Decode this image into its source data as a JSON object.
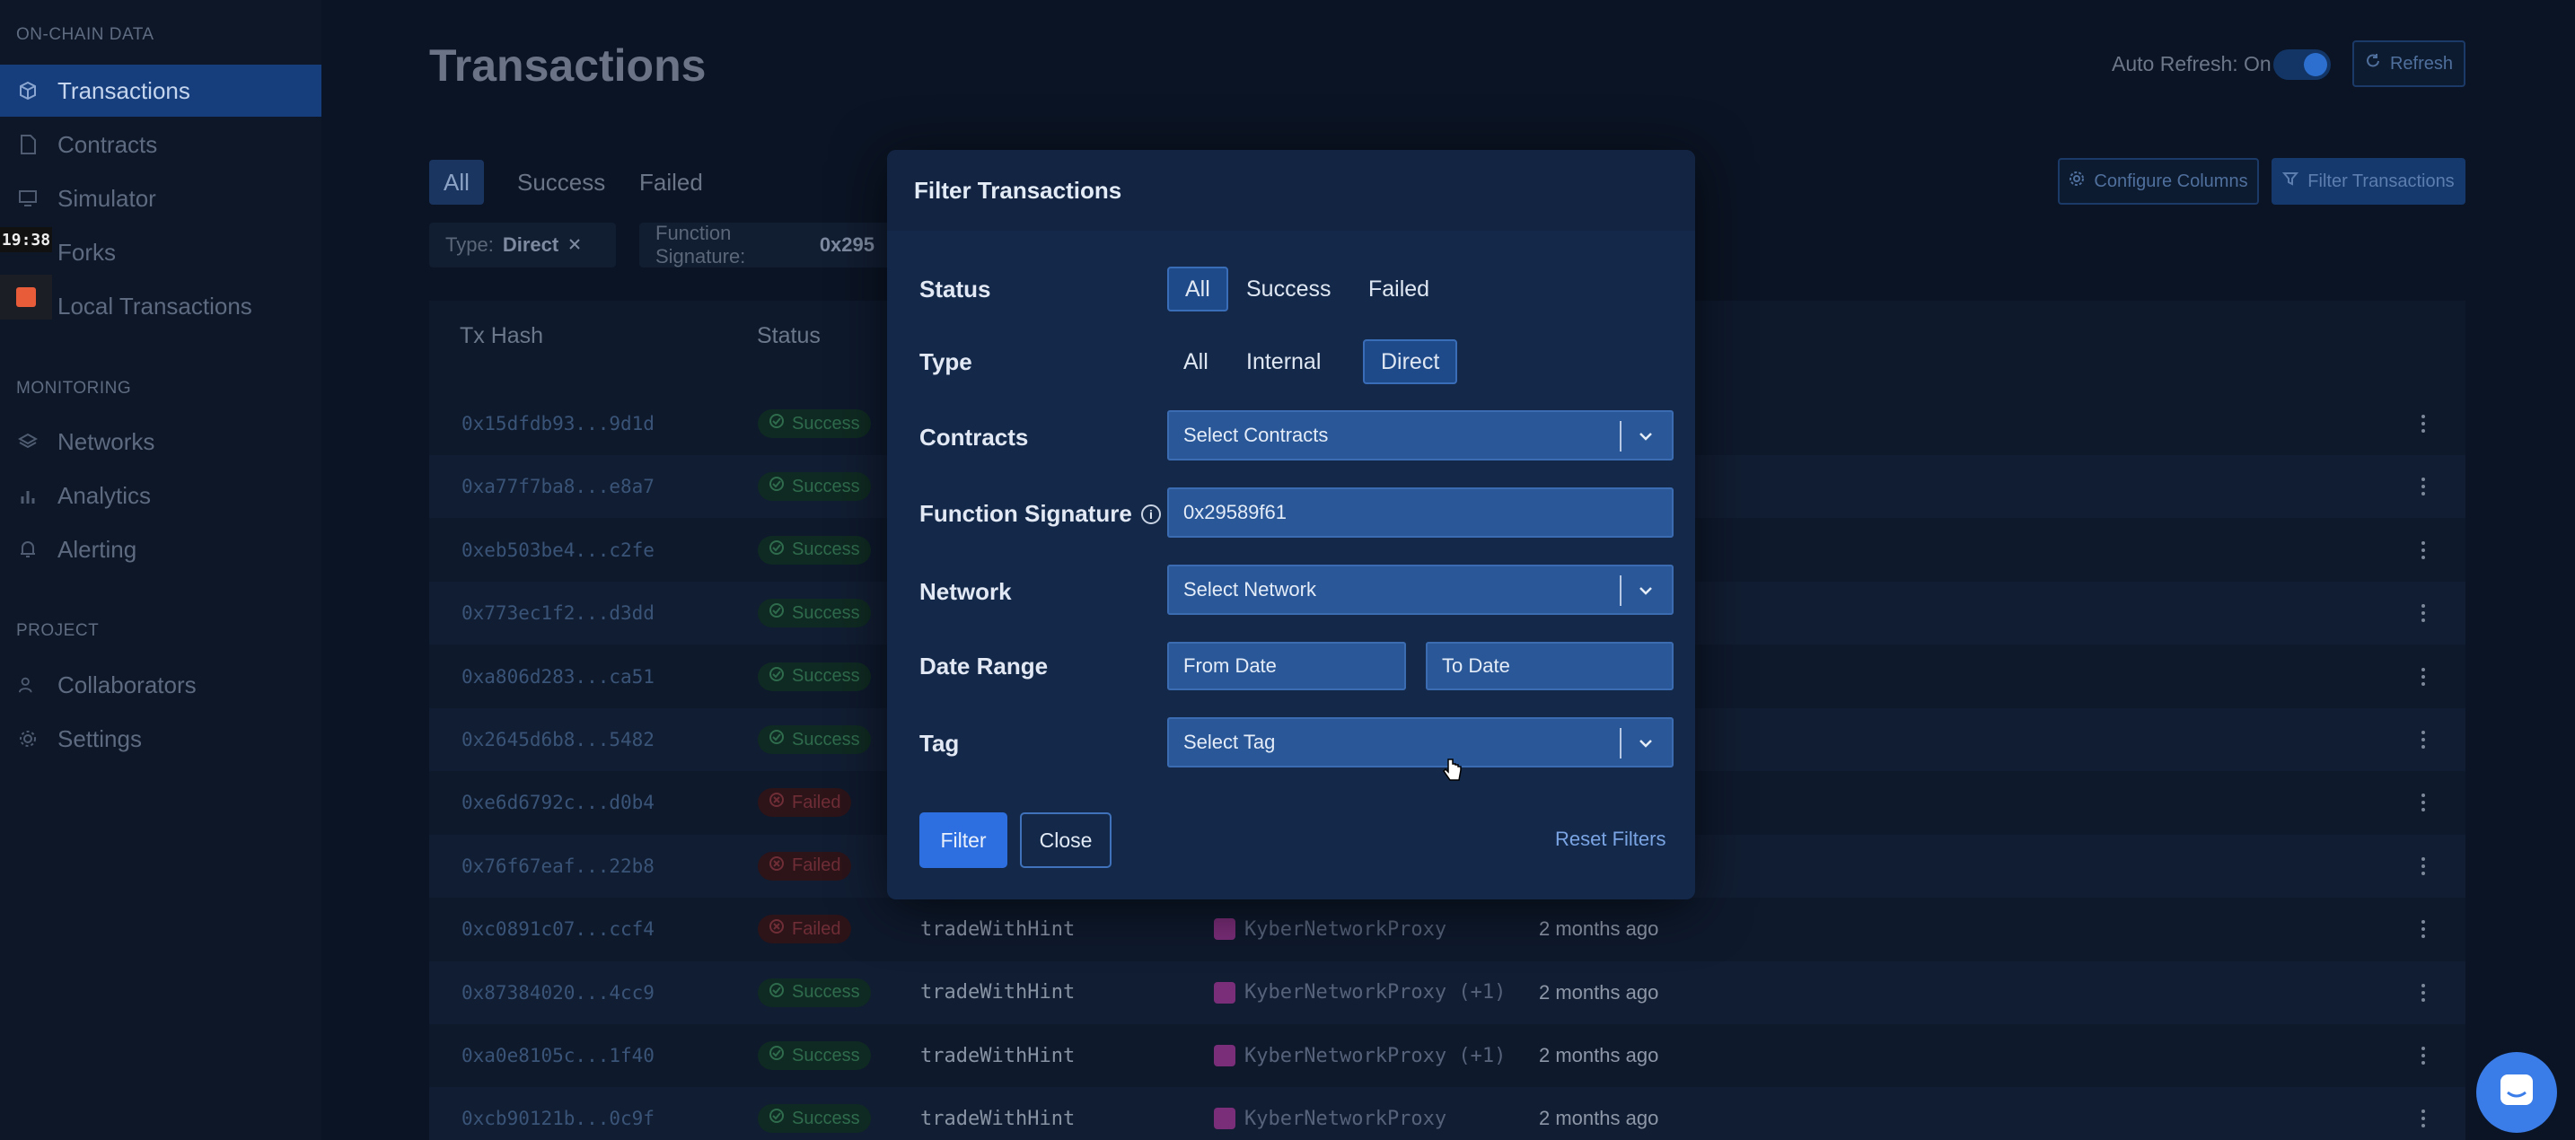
{
  "sidebar": {
    "section_onchain": "ON-CHAIN DATA",
    "section_monitoring": "MONITORING",
    "section_project": "PROJECT",
    "items": [
      {
        "label": "Transactions"
      },
      {
        "label": "Contracts"
      },
      {
        "label": "Simulator"
      },
      {
        "label": "Forks"
      },
      {
        "label": "Local Transactions"
      },
      {
        "label": "Networks"
      },
      {
        "label": "Analytics"
      },
      {
        "label": "Alerting"
      },
      {
        "label": "Collaborators"
      },
      {
        "label": "Settings"
      }
    ],
    "time_badge": "19:38"
  },
  "header": {
    "title": "Transactions",
    "auto_refresh_label": "Auto Refresh: On",
    "refresh_label": "Refresh",
    "configure_columns_label": "Configure Columns",
    "filter_transactions_label": "Filter Transactions"
  },
  "tabs": [
    {
      "label": "All"
    },
    {
      "label": "Success"
    },
    {
      "label": "Failed"
    }
  ],
  "chips": {
    "type_label": "Type:",
    "type_value": "Direct",
    "fn_label": "Function Signature:",
    "fn_value": "0x295"
  },
  "table": {
    "headers": {
      "tx_hash": "Tx Hash",
      "status": "Status"
    },
    "rows": [
      {
        "hash": "0x15dfdb93...9d1d",
        "status": "Success"
      },
      {
        "hash": "0xa77f7ba8...e8a7",
        "status": "Success"
      },
      {
        "hash": "0xeb503be4...c2fe",
        "status": "Success"
      },
      {
        "hash": "0x773ec1f2...d3dd",
        "status": "Success"
      },
      {
        "hash": "0xa806d283...ca51",
        "status": "Success"
      },
      {
        "hash": "0x2645d6b8...5482",
        "status": "Success"
      },
      {
        "hash": "0xe6d6792c...d0b4",
        "status": "Failed"
      },
      {
        "hash": "0x76f67eaf...22b8",
        "status": "Failed"
      },
      {
        "hash": "0xc0891c07...ccf4",
        "status": "Failed",
        "function": "tradeWithHint",
        "contract": "KyberNetworkProxy",
        "time": "2 months ago"
      },
      {
        "hash": "0x87384020...4cc9",
        "status": "Success",
        "function": "tradeWithHint",
        "contract": "KyberNetworkProxy (+1)",
        "time": "2 months ago"
      },
      {
        "hash": "0xa0e8105c...1f40",
        "status": "Success",
        "function": "tradeWithHint",
        "contract": "KyberNetworkProxy (+1)",
        "time": "2 months ago"
      },
      {
        "hash": "0xcb90121b...0c9f",
        "status": "Success",
        "function": "tradeWithHint",
        "contract": "KyberNetworkProxy",
        "time": "2 months ago"
      }
    ]
  },
  "modal": {
    "title": "Filter Transactions",
    "status_label": "Status",
    "status_options": [
      "All",
      "Success",
      "Failed"
    ],
    "type_label": "Type",
    "type_options": [
      "All",
      "Internal",
      "Direct"
    ],
    "contracts_label": "Contracts",
    "contracts_placeholder": "Select Contracts",
    "fn_label": "Function Signature",
    "fn_value": "0x29589f61",
    "network_label": "Network",
    "network_placeholder": "Select Network",
    "date_label": "Date Range",
    "from_placeholder": "From Date",
    "to_placeholder": "To Date",
    "tag_label": "Tag",
    "tag_placeholder": "Select Tag",
    "filter_button": "Filter",
    "close_button": "Close",
    "reset_link": "Reset Filters"
  }
}
